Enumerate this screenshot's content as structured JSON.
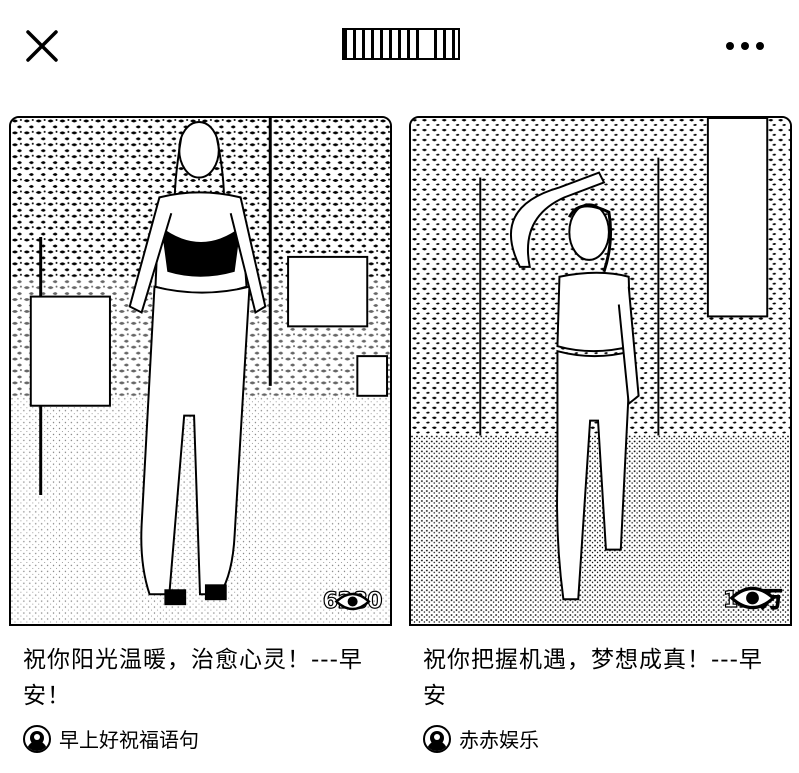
{
  "header": {
    "close_icon": "close-icon",
    "title": "",
    "more_icon": "more-horizontal-icon"
  },
  "cards": [
    {
      "views": "6280",
      "caption": "祝你阳光温暖，治愈心灵！---早安！",
      "author": "早上好祝福语句",
      "avatar_icon": "avatar-icon"
    },
    {
      "views": "1.2万",
      "caption": "祝你把握机遇，梦想成真！---早安",
      "author": "赤赤娱乐",
      "avatar_icon": "avatar-icon"
    }
  ]
}
